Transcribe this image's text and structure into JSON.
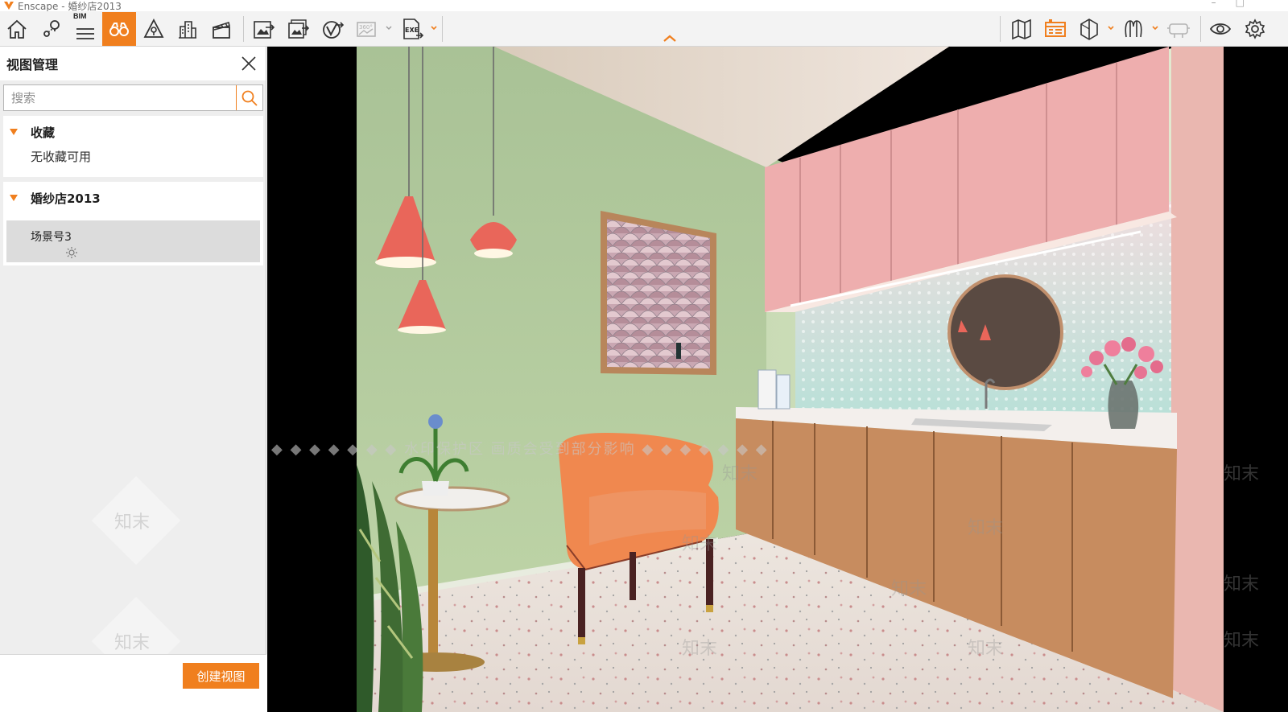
{
  "window": {
    "title": "Enscape - 婚纱店2013"
  },
  "toolbar": {
    "bim_label": "BIM",
    "left_tools": [
      "home-icon",
      "location-pin-icon",
      "bim-icon",
      "binoculars-icon",
      "warning-cone-icon",
      "city-icon",
      "clapperboard-icon"
    ],
    "export_tools": [
      "export-image-icon",
      "batch-export-icon",
      "web-standalone-icon",
      "panorama-360-icon",
      "exe-export-icon"
    ],
    "panorama_label": "360°",
    "exe_label": "EXE",
    "right_tools": [
      "map-icon",
      "asset-library-icon",
      "object-icon",
      "material-icon",
      "vr-headset-icon",
      "eye-icon",
      "gear-icon"
    ]
  },
  "panel": {
    "title": "视图管理",
    "search": {
      "placeholder": "搜索",
      "value": ""
    },
    "favorites": {
      "title": "收藏",
      "empty_text": "无收藏可用"
    },
    "project": {
      "title": "婚纱店2013",
      "views": [
        {
          "label": "场景号3"
        }
      ]
    },
    "create_button": "创建视图"
  },
  "viewport": {
    "watermark_band": "◆ ◆ ◆ ◆ ◆ ◆ ◆ 水印保护区  画质会受到部分影响 ◆ ◆ ◆ ◆ ◆ ◆ ◆",
    "watermark_brand": "知末"
  },
  "colors": {
    "accent": "#f07f1e",
    "wall_green": "#b9cea1",
    "cabinet_pink": "#eeb1ac",
    "wood": "#c68b5b",
    "chair": "#f0884f",
    "lamp": "#e9665a"
  }
}
